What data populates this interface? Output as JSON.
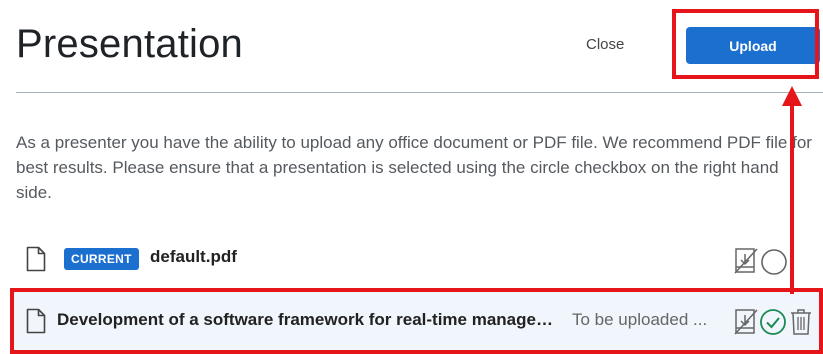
{
  "header": {
    "title": "Presentation",
    "close_label": "Close",
    "upload_label": "Upload"
  },
  "description": "As a presenter you have the ability to upload any office document or PDF file. We recommend PDF file for best results. Please ensure that a presentation is selected using the circle checkbox on the right hand side.",
  "files": [
    {
      "badge": "CURRENT",
      "name": "default.pdf",
      "status": "",
      "icons": [
        "file-icon",
        "no-download-icon",
        "select-circle-icon"
      ]
    },
    {
      "badge": "",
      "name": "Development of a software framework for real-time management",
      "status": "To be uploaded ...",
      "icons": [
        "file-icon",
        "no-download-icon",
        "selected-check-icon",
        "trash-icon"
      ]
    }
  ],
  "colors": {
    "primary": "#1b6fcf",
    "highlight": "#e5151a",
    "row_bg": "#f0f6fb",
    "check": "#1c8a52"
  }
}
